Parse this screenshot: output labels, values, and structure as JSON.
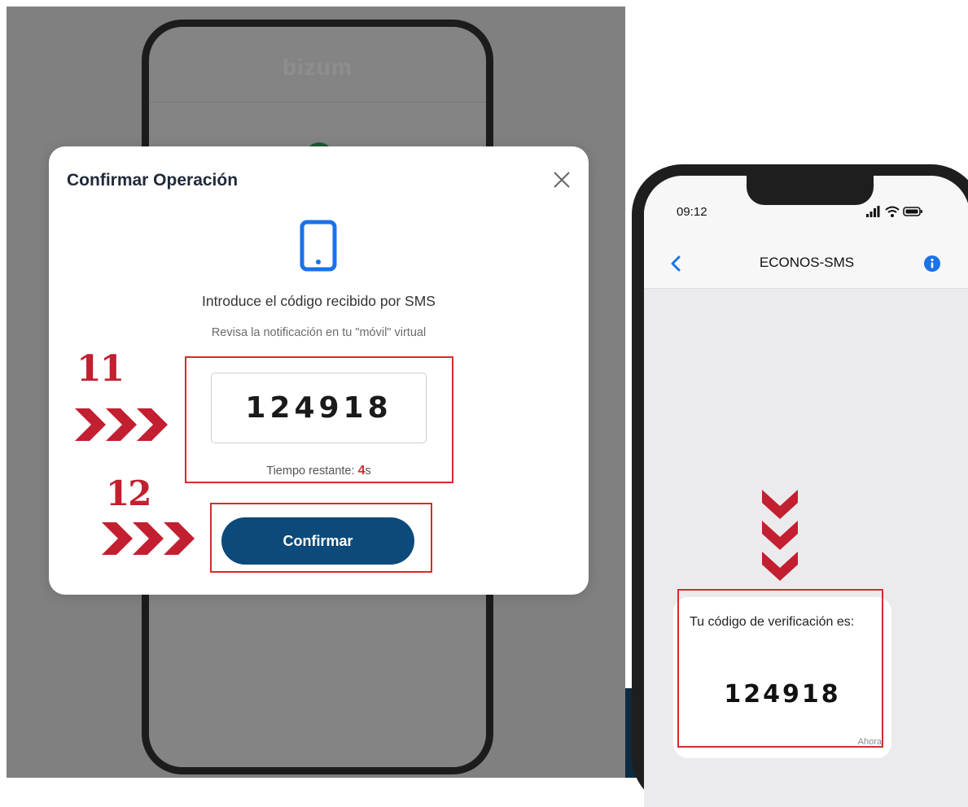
{
  "background_app": {
    "brand": "bizum"
  },
  "modal": {
    "title": "Confirmar Operación",
    "prompt": "Introduce el código recibido por SMS",
    "hint": "Revisa la notificación en tu \"móvil\" virtual",
    "code_value": "124918",
    "timer_label": "Tiempo restante: ",
    "timer_value": "4",
    "timer_unit": "s",
    "confirm_label": "Confirmar",
    "accent_color": "#0b4a7a",
    "icon_color": "#1a73e8"
  },
  "annotations": {
    "step_11": "11",
    "step_12": "12",
    "highlight_color": "#d72b2b",
    "step_color": "#c21f31"
  },
  "phone": {
    "time": "09:12",
    "contact": "ECONOS-SMS",
    "message_line": "Tu código de verificación es:",
    "message_code": "124918",
    "message_time": "Ahora"
  }
}
